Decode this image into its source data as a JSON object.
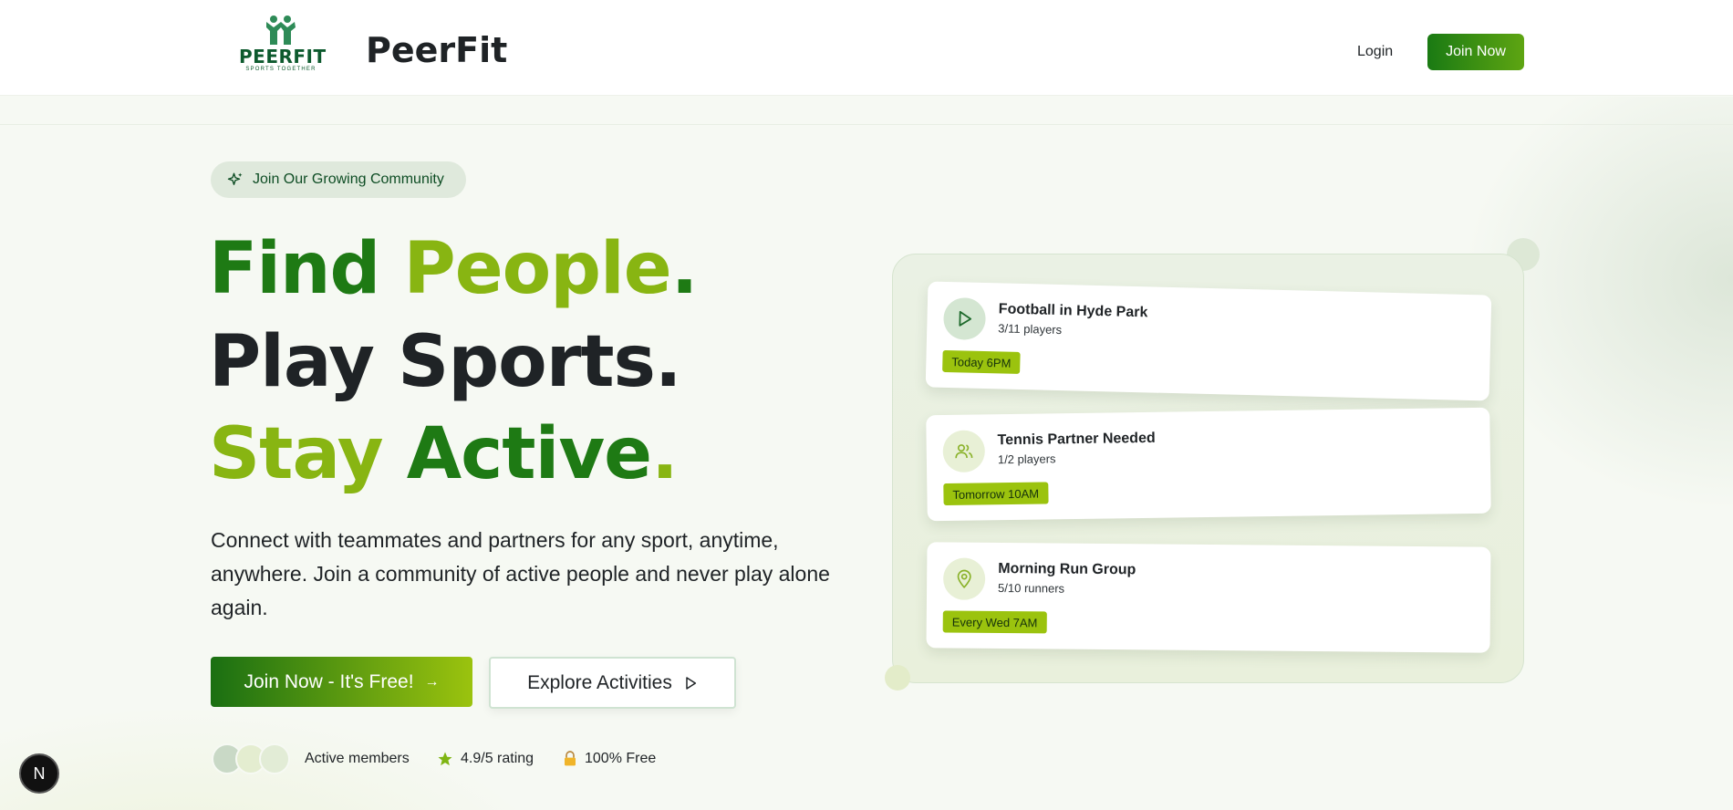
{
  "header": {
    "logo_word": "PEERFIT",
    "logo_tagline": "SPORTS TOGETHER",
    "brand_name": "PeerFit",
    "login_label": "Login",
    "join_label": "Join Now"
  },
  "hero": {
    "badge_label": "Join Our Growing Community",
    "headline": {
      "line1_word1": "Find",
      "line1_word2": "People",
      "line2": "Play Sports",
      "line3_word1": "Stay",
      "line3_word2": "Active",
      "period": "."
    },
    "description": "Connect with teammates and partners for any sport, anytime, anywhere. Join a community of active people and never play alone again.",
    "primary_cta": "Join Now - It's Free!",
    "primary_cta_arrow": "→",
    "secondary_cta": "Explore Activities",
    "stats": {
      "members": "Active members",
      "rating": "4.9/5 rating",
      "free": "100% Free"
    }
  },
  "activities": [
    {
      "title": "Football in Hyde Park",
      "players": "3/11 players",
      "time": "Today 6PM",
      "icon": "play-icon"
    },
    {
      "title": "Tennis Partner Needed",
      "players": "1/2 players",
      "time": "Tomorrow 10AM",
      "icon": "users-icon"
    },
    {
      "title": "Morning Run Group",
      "players": "5/10 runners",
      "time": "Every Wed 7AM",
      "icon": "map-pin-icon"
    }
  ],
  "dev_badge": "N",
  "colors": {
    "brand_dark_green": "#1e7a14",
    "brand_lime": "#88b512",
    "tag_lime": "#9bc30e",
    "logo_green": "#0d5a2e"
  }
}
